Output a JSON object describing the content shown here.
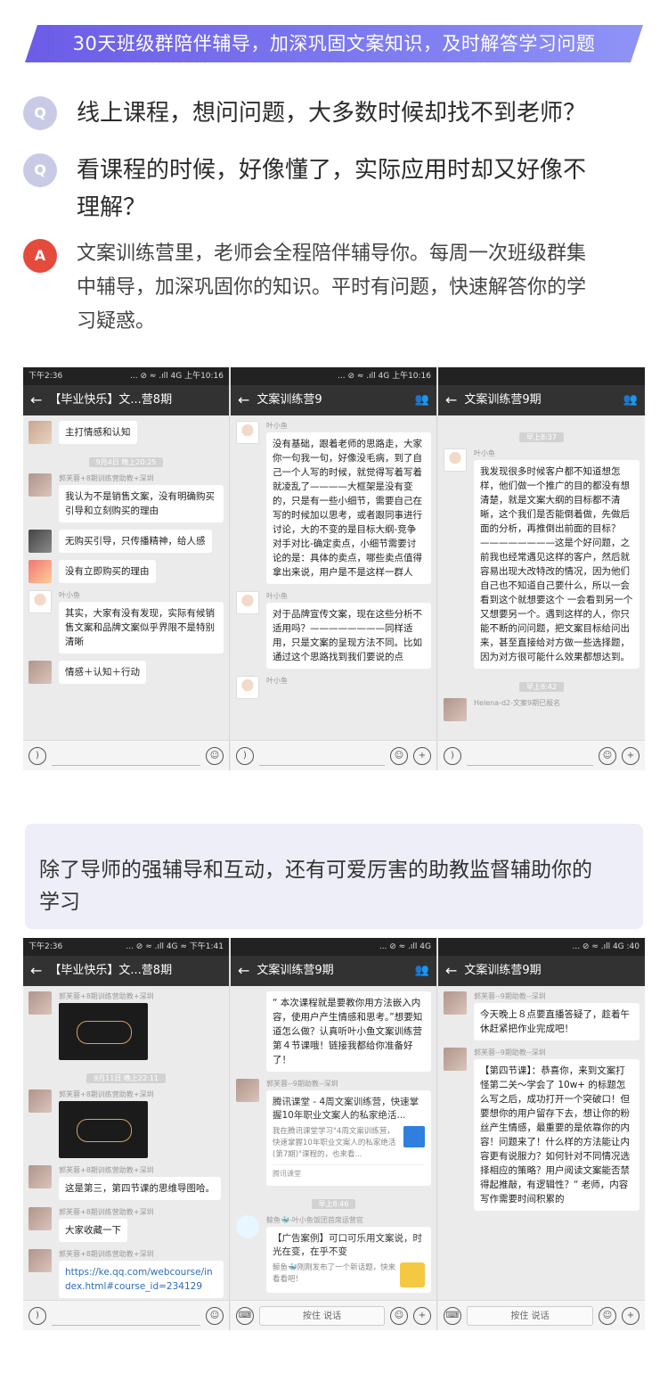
{
  "banner": {
    "text": "30天班级群陪伴辅导，加深巩固文案知识，及时解答学习问题"
  },
  "qa": {
    "q_badge": "Q",
    "a_badge": "A",
    "q1": "线上课程，想问问题，大多数时候却找不到老师？",
    "q2_line1": "看课程的时候，好像懂了，实际应用时却又好像不",
    "q2_line2": "理解？",
    "a_line1": "文案训练营里，老师会全程陪伴辅导你。每周一次班级群集",
    "a_line2": "中辅导，加深巩固你的知识。平时有问题，快速解答你的学",
    "a_line3": "习疑惑。"
  },
  "colors": {
    "banner": "#6c5ce7",
    "q_badge": "#c9cbe6",
    "a_badge": "#e44b3c"
  },
  "strip1": {
    "phone1": {
      "status_left": "下午2:36",
      "status_right": "... ⊘ ≈ .ıll 4G 上午10:16",
      "title": "【毕业快乐】文...营8期",
      "msgs": [
        {
          "text": "主打情感和认知"
        },
        {
          "time": "9月4日 晚上20:25"
        },
        {
          "sender": "郭芙蓉+8期训练营助教+深圳",
          "text": "我认为不是销售文案，没有明确购买引导和立刻购买的理由"
        },
        {
          "text": "无购买引导，只传播精神，给人感"
        },
        {
          "text": "没有立即购买的理由"
        },
        {
          "sender": "叶小鱼",
          "text": "其实，大家有没有发现，实际有候销售文案和品牌文案似乎界限不是特别清晰"
        },
        {
          "text": "情感＋认知＋行动"
        }
      ]
    },
    "phone2": {
      "status_right": "... ⊘ ≈ .ıll 4G 上午10:16",
      "title": "文案训练营9",
      "msgs": [
        {
          "sender": "叶小鱼",
          "text": "没有基础，跟着老师的思路走，大家你一句我一句，好像没毛病，到了自己一个人写的时候，就觉得写着写着就凌乱了————大框架是没有变的，只是有一些小细节，需要自己在写的时候加以思考，或者跟同事进行讨论，大的不变的是目标大纲-竞争对手对比-确定卖点，小细节需要讨论的是：具体的卖点，哪些卖点值得拿出来说，用户是不是这样一群人"
        },
        {
          "sender": "叶小鱼",
          "text": "对于品牌宣传文案，现在这些分析不适用吗？————————同样适用，只是文案的呈现方法不同。比如通过这个思路找到我们要说的点"
        },
        {
          "sender": "叶小鱼",
          "text": ""
        }
      ]
    },
    "phone3": {
      "title": "文案训练营9期",
      "msgs": [
        {
          "time": "早上8:37"
        },
        {
          "sender": "叶小鱼",
          "text": "我发现很多时候客户都不知道想怎样，他们做一个推广的目的都没有想清楚，就是文案大纲的目标都不清晰，这个我们是否能倒着做，先做后面的分析，再推倒出前面的目标？————————这是个好问题，之前我也经常遇见这样的客户，然后就容易出现大改特改的情况，因为他们自己也不知道自己要什么，所以一会看到这个就想要这个 一会看到另一个 又想要另一个。遇到这样的人，你只能不断的问问题，把文案目标给问出来，甚至直接给对方做一些选择题，因为对方很可能什么效果都想达到。"
        },
        {
          "time": "早上8:42"
        },
        {
          "sender": "Helena-d2-文案9期已报名",
          "text": ""
        }
      ]
    }
  },
  "panel": {
    "line1": "除了导师的强辅导和互动，还有可爱厉害的助教监督辅助你的",
    "line2": "学习"
  },
  "strip2": {
    "phone1": {
      "status_left": "下午2:36",
      "status_right": "... ⊘ ≈ .ıll 4G ≈ 下午1:41",
      "title": "【毕业快乐】文...营8期",
      "msgs": [
        {
          "sender": "郭芙蓉+8期训练营助教+深圳",
          "image": true
        },
        {
          "time": "9月11日 晚上22:11"
        },
        {
          "sender": "郭芙蓉+8期训练营助教+深圳",
          "image": true
        },
        {
          "sender": "郭芙蓉+8期训练营助教+深圳",
          "text": "这是第三，第四节课的思维导图哈。"
        },
        {
          "sender": "郭芙蓉+8期训练营助教+深圳",
          "text": "大家收藏一下"
        },
        {
          "sender": "郭芙蓉+8期训练营助教+深圳",
          "text": "https://ke.qq.com/webcourse/index.html#course_id=234129"
        }
      ]
    },
    "phone2": {
      "status_right": "... ⊘ ≈ .ıll 4G",
      "title": "文案训练营9期",
      "msgs": [
        {
          "text": "“ 本次课程就是要教你用方法嵌入内容，使用户产生情感和思考。”想要知道怎么做？认真听叶小鱼文案训练营第４节课哦！链接我都给你准备好了！"
        },
        {
          "sender": "郭芙蓉--9期助教--深圳",
          "card_title": "腾讯课堂 - 4周文案训练营，快速掌握10年职业文案人的私家绝活...",
          "card_sub": "我在腾讯课堂学习\"4周文案训练营，快速掌握10年职业文案人的私家绝活(第7期)\"课程的，也来看...",
          "card_src": "腾讯课堂"
        },
        {
          "time": "早上8:46"
        },
        {
          "sender": "鲸鱼🐳-叶小鱼饭团首席运营官",
          "card_title": "【广告案例】可口可乐用文案说，时光在变，在乎不变",
          "card_sub": "鲸鱼🐳刚刚发布了一个新话题，快来看看吧！"
        }
      ],
      "input": "按住 说话"
    },
    "phone3": {
      "status_right": "... ⊘ ≈ .ıll 4G :40",
      "title": "文案训练营9期",
      "msgs": [
        {
          "sender": "郭芙蓉--9期助教--深圳",
          "text": "今天晚上８点要直播答疑了，趁着午休赶紧把作业完成吧！"
        },
        {
          "sender": "郭芙蓉--9期助教--深圳",
          "text": "【第四节课】：恭喜你，来到文案打怪第二关～学会了 10w+ 的标题怎么写之后，成功打开一个突破口！但要想你的用户留存下去，想让你的粉丝产生情感，最重要的是依靠你的内容！问题来了！什么样的方法能让内容更有说服力？如何针对不同情况选择相应的策略？用户阅读文案能否禁得起推敲，有逻辑性？“ 老师，内容写作需要时间积累的"
        }
      ],
      "input": "按住 说话"
    }
  }
}
